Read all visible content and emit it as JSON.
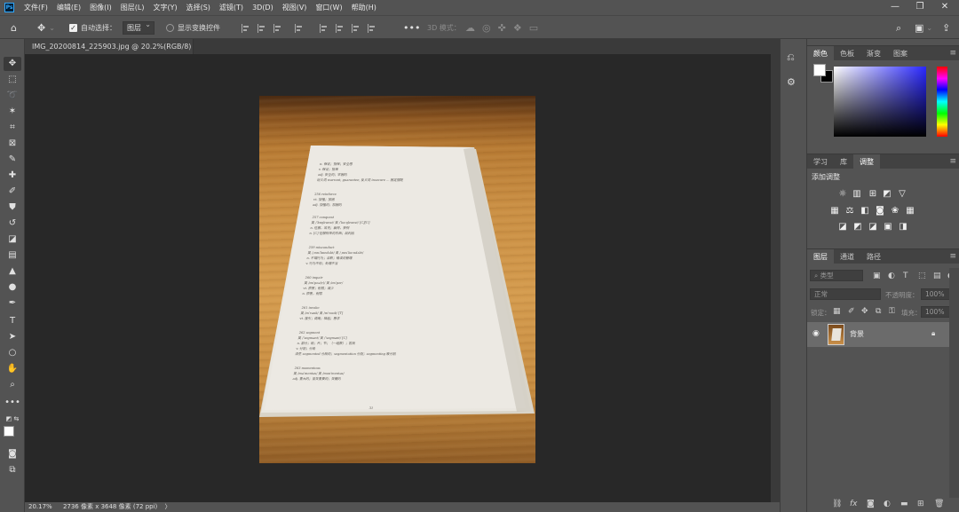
{
  "app": {
    "logo_text": "Ps"
  },
  "menu": [
    "文件(F)",
    "编辑(E)",
    "图像(I)",
    "图层(L)",
    "文字(Y)",
    "选择(S)",
    "滤镜(T)",
    "3D(D)",
    "视图(V)",
    "窗口(W)",
    "帮助(H)"
  ],
  "window_controls": {
    "minimize": "—",
    "maximize": "❐",
    "close": "✕"
  },
  "options": {
    "auto_select_label": "自动选择：",
    "auto_select_target": "图层",
    "show_transform_label": "显示变换控件",
    "mode_3d_label": "3D 模式："
  },
  "document": {
    "tab_title": "IMG_20200814_225903.jpg @ 20.2%(RGB/8)",
    "tab_close": "×"
  },
  "status": {
    "zoom": "20.17%",
    "dimensions": "2736 像素 x 3648 像素 (72 ppi)",
    "arrow": "〉"
  },
  "photo_text": {
    "page_number": "31",
    "entries": [
      "257 conquest",
      "259 misconduct",
      "260 impair",
      "261 invoke",
      "262 segment",
      "263 momentous"
    ]
  },
  "panels": {
    "color_tabs": [
      "颜色",
      "色板",
      "渐变",
      "图案"
    ],
    "adjust_tabs": [
      "学习",
      "库",
      "调整"
    ],
    "adjust_title": "添加调整",
    "layers_tabs": [
      "图层",
      "通道",
      "路径"
    ],
    "filter_kind": "类型",
    "blend_mode": "正常",
    "opacity_label": "不透明度：",
    "opacity_value": "100%",
    "lock_label": "锁定：",
    "fill_label": "填充：",
    "fill_value": "100%",
    "layer_name": "背景"
  },
  "colors": {
    "ui_dark": "#282828",
    "ui_panel": "#535353",
    "ui_tab": "#424242",
    "accent_hue_field": "#2a28ff"
  },
  "icons": {
    "tools": [
      "move-tool-icon",
      "marquee-tool-icon",
      "lasso-tool-icon",
      "magic-wand-icon",
      "crop-tool-icon",
      "frame-tool-icon",
      "eyedropper-icon",
      "healing-brush-icon",
      "brush-tool-icon",
      "clone-stamp-icon",
      "history-brush-icon",
      "eraser-icon",
      "gradient-tool-icon",
      "blur-tool-icon",
      "dodge-tool-icon",
      "pen-tool-icon",
      "type-tool-icon",
      "path-selection-icon",
      "ellipse-tool-icon",
      "hand-tool-icon",
      "zoom-tool-icon",
      "more-tools-icon"
    ]
  }
}
